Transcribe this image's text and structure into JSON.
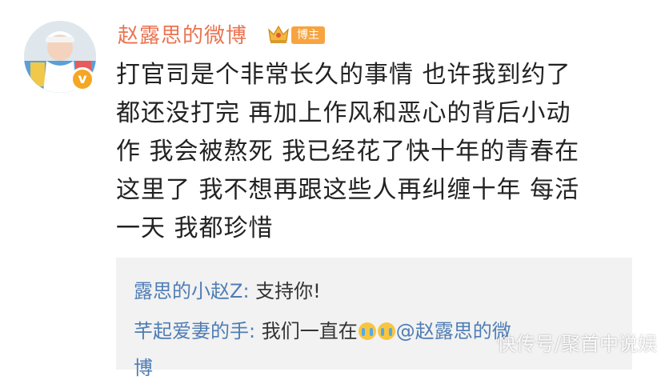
{
  "user": {
    "name": "赵露思的微博",
    "badge": "博主",
    "verified_icon": "v-badge-icon",
    "verified_mark": "v"
  },
  "post": {
    "lines": [
      "打官司是个非常长久的事情 也许我到约了",
      "都还没打完 再加上作风和恶心的背后小动",
      "作 我会被熬死 我已经花了快十年的青春在",
      "这里了 我不想再跟这些人再纠缠十年 每活",
      "一天 我都珍惜"
    ]
  },
  "comments": [
    {
      "author": "露思的小赵Z:",
      "text": "支持你!"
    },
    {
      "author": "芊起爱妻的手:",
      "text_before": "我们一直在",
      "emoji_count": 2,
      "mention": "@赵露思的微",
      "overflow": "博"
    }
  ],
  "watermark": "快传号/聚首中说娱",
  "colors": {
    "name": "#eb7350",
    "link": "#4f7db5",
    "badge": "#f7a440",
    "comment_bg": "#f2f2f2"
  }
}
